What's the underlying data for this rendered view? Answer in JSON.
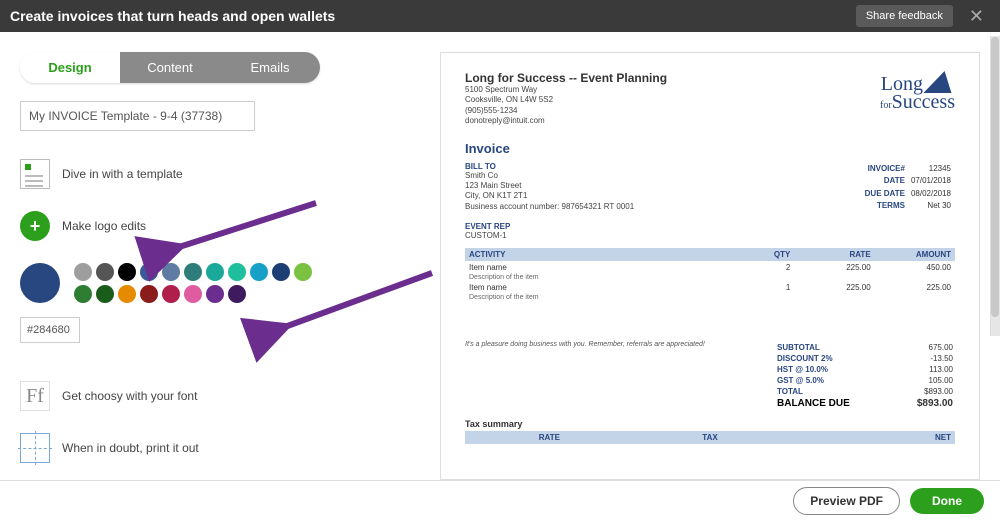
{
  "header": {
    "title": "Create invoices that turn heads and open wallets",
    "share": "Share feedback"
  },
  "tabs": {
    "design": "Design",
    "content": "Content",
    "emails": "Emails"
  },
  "template_name": "My INVOICE Template - 9-4 (37738)",
  "options": {
    "dive": "Dive in with a template",
    "logo": "Make logo edits",
    "font": "Get choosy with your font",
    "print": "When in doubt, print it out"
  },
  "color": {
    "hex": "#284680",
    "swatches": [
      "#9e9e9e",
      "#555555",
      "#000000",
      "#3b5998",
      "#5d7ba3",
      "#2e7d7a",
      "#1aa89a",
      "#1fbf9d",
      "#18a0c7",
      "#1b3e73",
      "#7ac142",
      "#2e7d32",
      "#1a5d1a",
      "#e68a00",
      "#8a1c1c",
      "#b01e4b",
      "#e05ca0",
      "#6b2e8f",
      "#3e1b5e"
    ]
  },
  "invoice": {
    "company": "Long for Success -- Event Planning",
    "addr1": "5100 Spectrum Way",
    "addr2": "Cooksville, ON L4W 5S2",
    "phone": "(905)555-1234",
    "email": "donotreply@intuit.com",
    "logo_line1": "Long",
    "logo_for": "for",
    "logo_line2": "Success",
    "title": "Invoice",
    "billto_label": "BILL TO",
    "billto_name": "Smith Co",
    "billto_street": "123 Main Street",
    "billto_city": "City, ON K1T 2T1",
    "billto_bn": "Business account number: 987654321 RT 0001",
    "meta": {
      "invoice_no_label": "INVOICE#",
      "invoice_no": "12345",
      "date_label": "DATE",
      "date": "07/01/2018",
      "due_label": "DUE DATE",
      "due": "08/02/2018",
      "terms_label": "TERMS",
      "terms": "Net 30"
    },
    "rep_label": "EVENT REP",
    "rep_value": "CUSTOM-1",
    "cols": {
      "activity": "ACTIVITY",
      "qty": "QTY",
      "rate": "RATE",
      "amount": "AMOUNT"
    },
    "items": [
      {
        "name": "Item name",
        "desc": "Description of the item",
        "qty": "2",
        "rate": "225.00",
        "amount": "450.00"
      },
      {
        "name": "Item name",
        "desc": "Description of the item",
        "qty": "1",
        "rate": "225.00",
        "amount": "225.00"
      }
    ],
    "thanks": "It's a pleasure doing business with you. Remember, referrals are appreciated!",
    "totals": {
      "subtotal_label": "SUBTOTAL",
      "subtotal": "675.00",
      "discount_label": "DISCOUNT 2%",
      "discount": "-13.50",
      "hst_label": "HST @ 10.0%",
      "hst": "113.00",
      "gst_label": "GST @ 5.0%",
      "gst": "105.00",
      "total_label": "TOTAL",
      "total": "$893.00",
      "balance_label": "BALANCE DUE",
      "balance": "$893.00"
    },
    "tax_summary_label": "Tax summary",
    "tax_cols": {
      "rate": "RATE",
      "tax": "TAX",
      "net": "NET"
    }
  },
  "buttons": {
    "preview": "Preview PDF",
    "done": "Done"
  }
}
